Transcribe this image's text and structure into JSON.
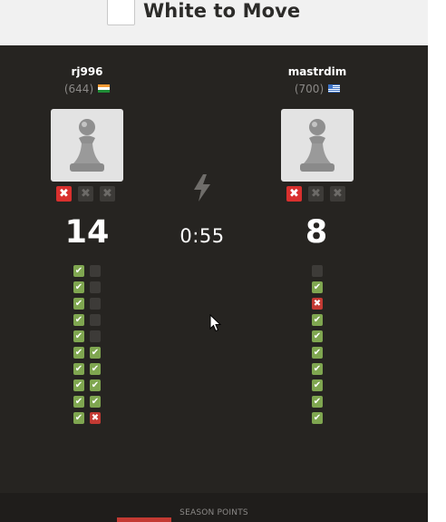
{
  "header": {
    "title": "White to Move"
  },
  "colors": {
    "correct": "#7fa650",
    "wrong": "#c33a33",
    "strike_active": "#d9302e",
    "board_bg": "#262421"
  },
  "left_player": {
    "name": "rj996",
    "rating": "(644)",
    "flag": "india-flag-icon",
    "avatar": "pawn-icon",
    "strikes": [
      "x",
      "x",
      "x"
    ],
    "strikes_active": [
      true,
      false,
      false
    ],
    "score": "14",
    "col1": [
      "ok",
      "ok",
      "ok",
      "ok",
      "ok",
      "ok",
      "ok",
      "ok",
      "ok",
      "ok"
    ],
    "col2": [
      "empty",
      "empty",
      "empty",
      "empty",
      "empty",
      "ok",
      "ok",
      "ok",
      "ok",
      "bad"
    ]
  },
  "right_player": {
    "name": "mastrdim",
    "rating": "(700)",
    "flag": "greece-flag-icon",
    "avatar": "pawn-icon",
    "strikes": [
      "x",
      "x",
      "x"
    ],
    "strikes_active": [
      true,
      false,
      false
    ],
    "score": "8",
    "col1": [
      "empty",
      "ok",
      "bad",
      "ok",
      "ok",
      "ok",
      "ok",
      "ok",
      "ok",
      "ok"
    ]
  },
  "center": {
    "mode_icon": "lightning-bolt-icon",
    "timer": "0:55"
  },
  "footer": {
    "label": "SEASON POINTS"
  },
  "glyphs": {
    "check": "✔",
    "cross": "✖"
  }
}
